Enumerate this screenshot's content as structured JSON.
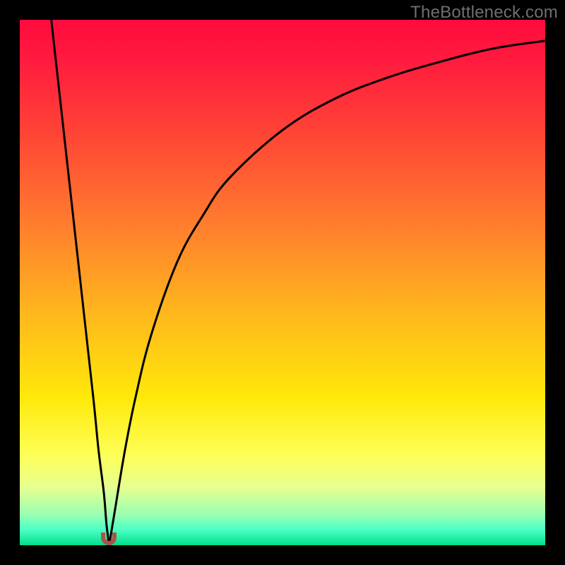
{
  "watermark": "TheBottleneck.com",
  "colors": {
    "gradient_top": "#ff0b3e",
    "gradient_mid": "#ffe90a",
    "gradient_bottom": "#00e08a",
    "curve": "#000000",
    "nub": "#b24e48",
    "frame": "#000000"
  },
  "chart_data": {
    "type": "line",
    "title": "",
    "xlabel": "",
    "ylabel": "",
    "xlim": [
      0,
      100
    ],
    "ylim": [
      0,
      100
    ],
    "grid": false,
    "legend": false,
    "annotations": [
      "TheBottleneck.com"
    ],
    "nub_x": 17,
    "series": [
      {
        "name": "left-branch",
        "x": [
          6,
          8,
          10,
          12,
          14,
          15,
          16,
          16.5,
          17
        ],
        "values": [
          100,
          82,
          64,
          46,
          28,
          18,
          10,
          4,
          0
        ]
      },
      {
        "name": "right-branch",
        "x": [
          17,
          18,
          20,
          22,
          25,
          30,
          35,
          40,
          50,
          60,
          70,
          80,
          90,
          100
        ],
        "values": [
          0,
          6,
          18,
          28,
          40,
          54,
          63,
          70,
          79,
          85,
          89,
          92,
          94.5,
          96
        ]
      }
    ]
  }
}
